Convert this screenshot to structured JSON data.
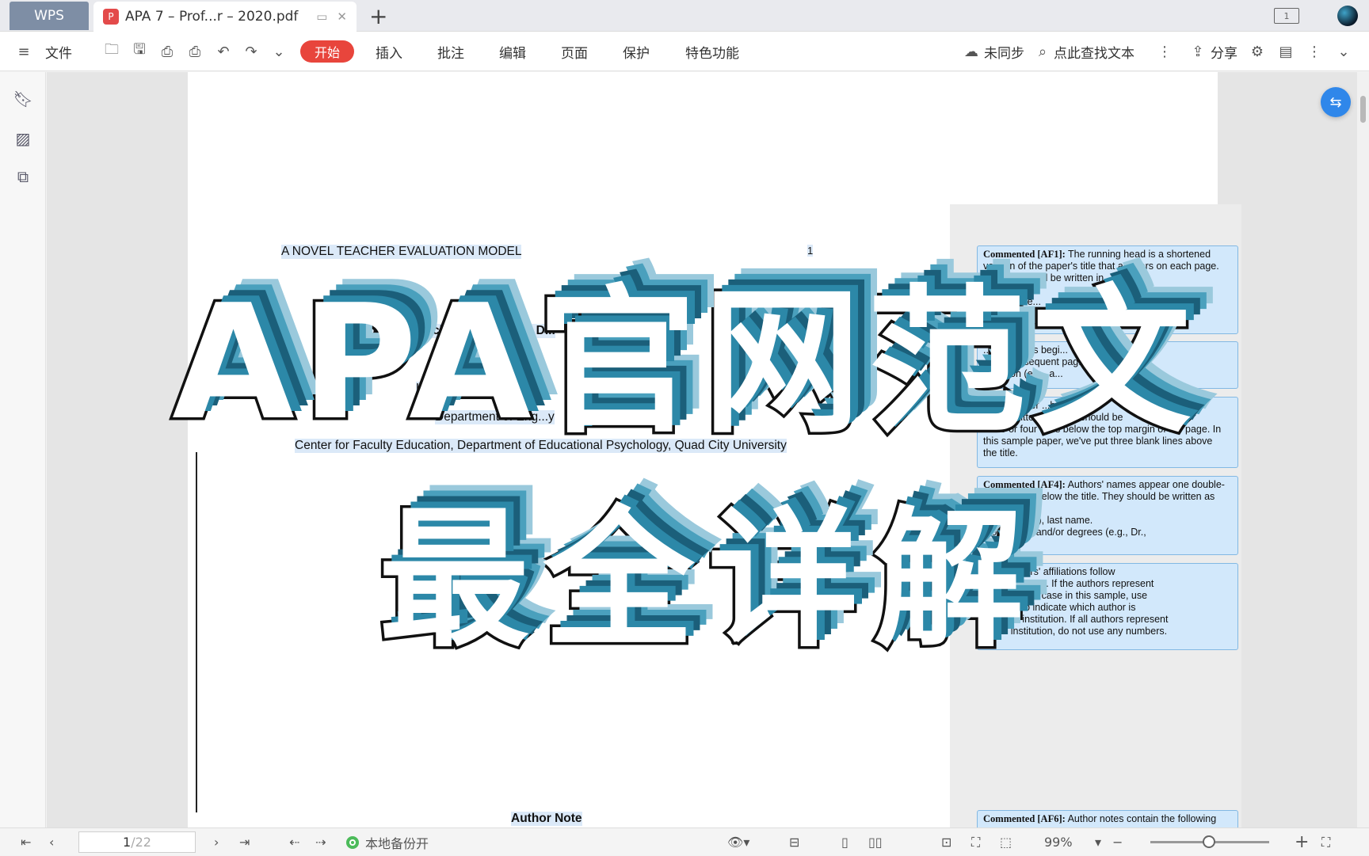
{
  "tabbar": {
    "app_tab": "WPS",
    "doc_tab_title": "APA 7 – Prof...r – 2020.pdf",
    "pdf_badge": "P",
    "new_tab": "+",
    "window_mode": "1"
  },
  "toolbar": {
    "file_label": "文件",
    "start_label": "开始",
    "menus": [
      "插入",
      "批注",
      "编辑",
      "页面",
      "保护",
      "特色功能"
    ],
    "sync_label": "未同步",
    "search_label": "点此查找文本",
    "share_label": "分享"
  },
  "document": {
    "running_head": "A NOVEL TEACHER EVALUATION MODEL",
    "page_number": "1",
    "title_fragment": "Predicting Pat... Teacher Ev... Faculty D...",
    "authors_fragment": "Kim A. ... James F... Nu",
    "affiliation1": "Department of Eng...y",
    "affiliation2": "Center for Faculty Education, Department of Educational Psychology, Quad City University",
    "author_note": "Author Note"
  },
  "comments": [
    {
      "head": "Commented [AF1]:",
      "text": "The running head is a shortened\nversion of the paper's title that appears on each page.\n...and it should be written in\n... to \"Ru...\n... the pape...\n...paces\n...d rather than ...ed form."
    },
    {
      "head": "",
      "text": "...e numbers begi...\n...ery subsequent pag...\n...mation (e.g., a..."
    },
    {
      "head": "Co...",
      "text": "...paper ...be\ncen... written in ...e. It should be\nthree or four lines below the top margin of the page. In\nthis sample paper, we've put three blank lines above\nthe title."
    },
    {
      "head": "Commented [AF4]:",
      "text": "Authors' names appear one double-\nspaced line below the title. They should be written as\n\n...dle initial(s), last name.\n...onal titles and/or degrees (e.g., Dr.,\n...)."
    },
    {
      "head": "...5]:",
      "text": "Authors' affiliations follow\n... their names. If the authors represent\n...s, as is the case in this sample, use\n...mbers to indicate which author is\n... which institution. If all authors represent\nthe ... institution, do not use any numbers."
    },
    {
      "head": "Commented [AF6]:",
      "text": "Author notes contain the following"
    }
  ],
  "overlay": {
    "line1": "APA官网范文",
    "line2": "最全详解"
  },
  "status": {
    "page_current": "1",
    "page_total": "/22",
    "backup_label": "本地备份开",
    "zoom": "99%"
  }
}
